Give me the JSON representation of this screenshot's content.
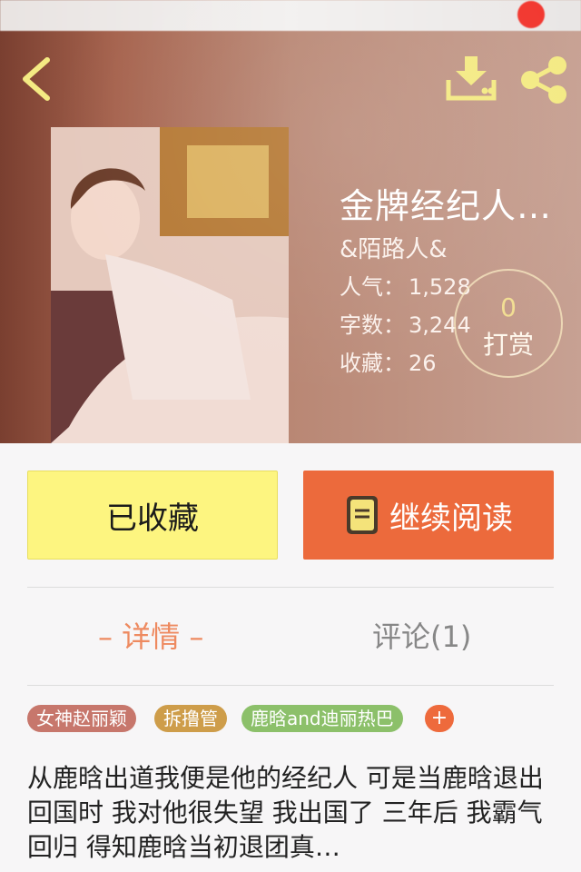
{
  "nav": {
    "back": "back",
    "download": "download",
    "share": "share"
  },
  "book": {
    "title": "金牌经纪人…",
    "author": "&陌路人&",
    "stats": [
      {
        "label": "人气：",
        "value": "1,528"
      },
      {
        "label": "字数：",
        "value": "3,244"
      },
      {
        "label": "收藏：",
        "value": "26"
      }
    ],
    "reward": {
      "count": "0",
      "label": "打赏"
    }
  },
  "actions": {
    "favorite": "已收藏",
    "continue_reading": "继续阅读"
  },
  "tabs": {
    "detail": "– 详情 –",
    "comments": "评论(1)"
  },
  "tags": [
    "女神赵丽颖",
    "拆撸管",
    "鹿晗and迪丽热巴",
    "+"
  ],
  "description": "从鹿晗出道我便是他的经纪人 可是当鹿晗退出回国时 我对他很失望 我出国了 三年后 我霸气回归 得知鹿晗当初退团真…",
  "colors": {
    "accent": "#ec6a3c",
    "favorite_bg": "#fdf580",
    "icon_yellow": "#f4ea83"
  }
}
